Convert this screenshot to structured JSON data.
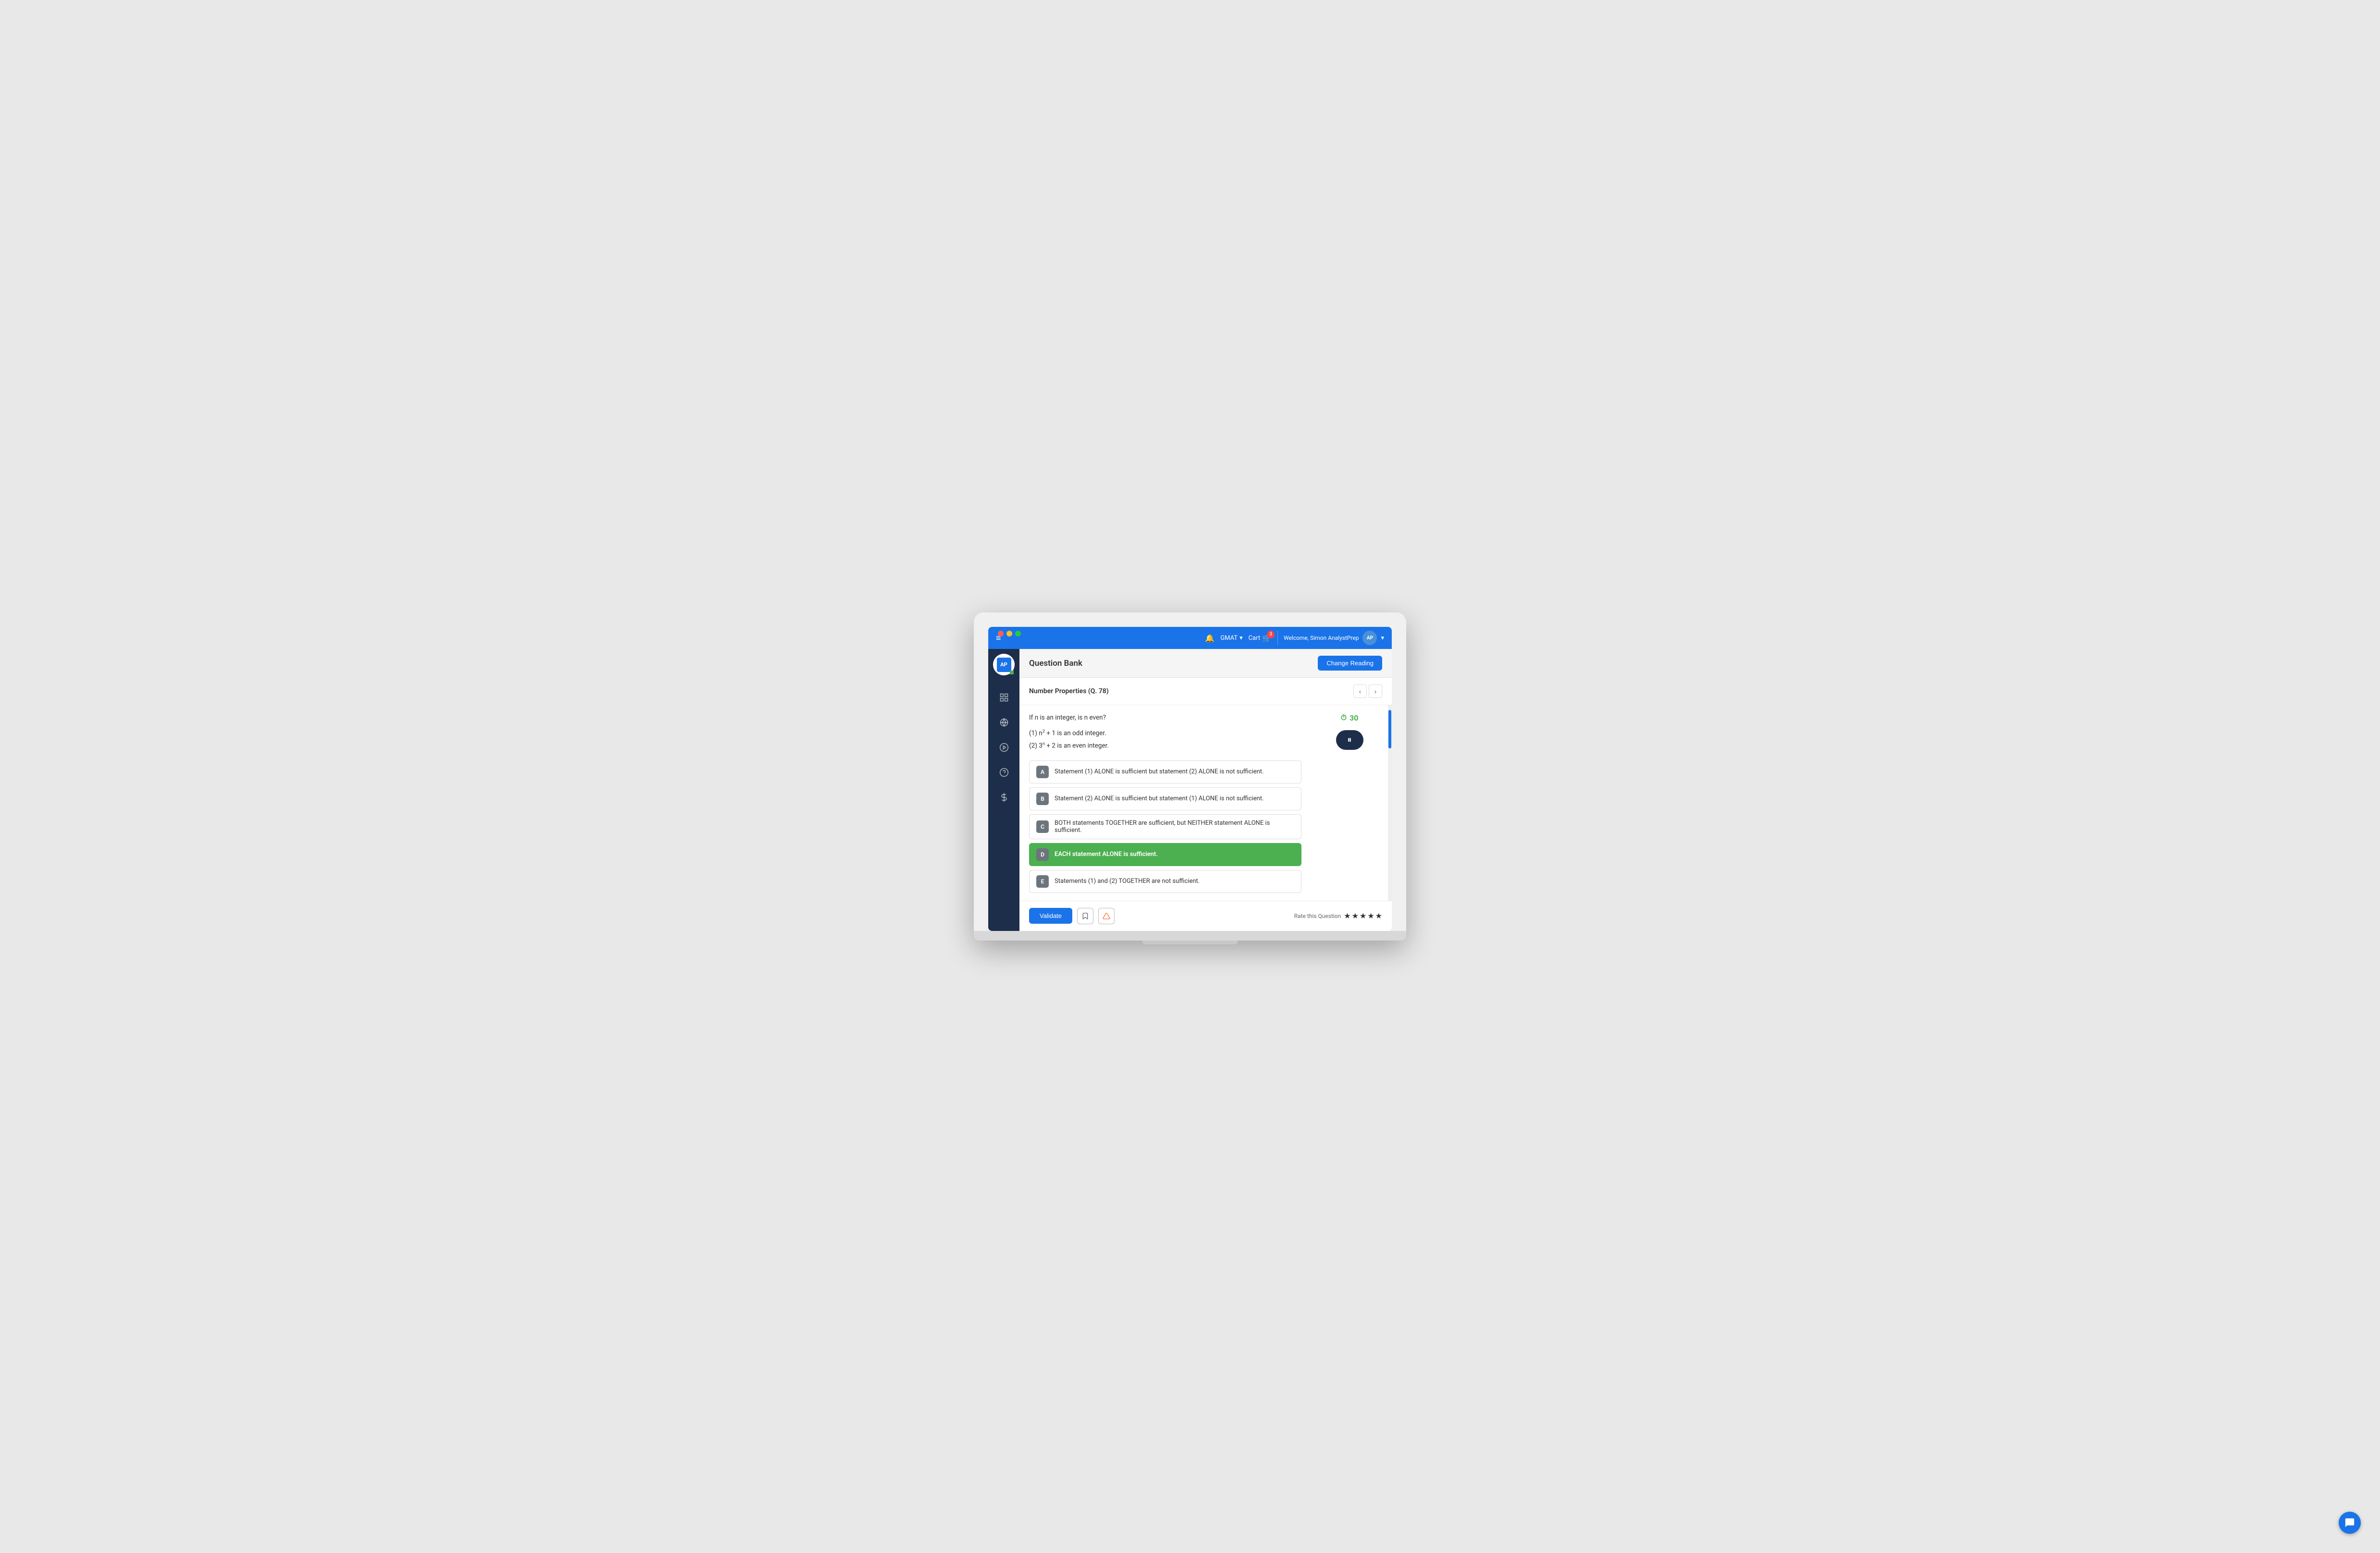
{
  "window": {
    "title": "AnalystPrep Question Bank"
  },
  "topbar": {
    "bell_icon": "🔔",
    "gmat_label": "GMAT",
    "cart_label": "Cart",
    "cart_count": "3",
    "user_greeting": "Welcome, Simon AnalystPrep",
    "hamburger": "≡"
  },
  "sidebar": {
    "logo_text": "AP",
    "items": [
      {
        "icon": "📊",
        "name": "dashboard"
      },
      {
        "icon": "🧠",
        "name": "practice"
      },
      {
        "icon": "▶",
        "name": "video"
      },
      {
        "icon": "💬",
        "name": "forum"
      },
      {
        "icon": "💰",
        "name": "pricing"
      }
    ]
  },
  "page": {
    "title": "Question Bank",
    "change_reading_label": "Change Reading"
  },
  "question": {
    "category": "Number Properties (Q. 78)",
    "text": "If n is an integer, is n even?",
    "statements": [
      "(1) n² + 1 is an odd integer.",
      "(2) 3ⁿ + 2 is an even integer."
    ],
    "timer_value": "30",
    "options": [
      {
        "label": "A",
        "text": "Statement (1) ALONE is sufficient but statement (2) ALONE is not sufficient.",
        "selected": false
      },
      {
        "label": "B",
        "text": "Statement (2) ALONE is sufficient but statement (1) ALONE is not sufficient.",
        "selected": false
      },
      {
        "label": "C",
        "text": "BOTH statements TOGETHER are sufficient, but NEITHER statement ALONE is sufficient.",
        "selected": false
      },
      {
        "label": "D",
        "text": "EACH statement ALONE is sufficient.",
        "selected": true
      },
      {
        "label": "E",
        "text": "Statements (1) and (2) TOGETHER are not sufficient.",
        "selected": false
      }
    ]
  },
  "bottom": {
    "validate_label": "Validate",
    "rate_label": "Rate this Question",
    "stars": [
      "★",
      "★",
      "★",
      "★",
      "★"
    ]
  },
  "colors": {
    "primary": "#1a73e8",
    "sidebar_bg": "#1c2e4a",
    "selected_option": "#4caf50",
    "timer_color": "#4caf50"
  }
}
